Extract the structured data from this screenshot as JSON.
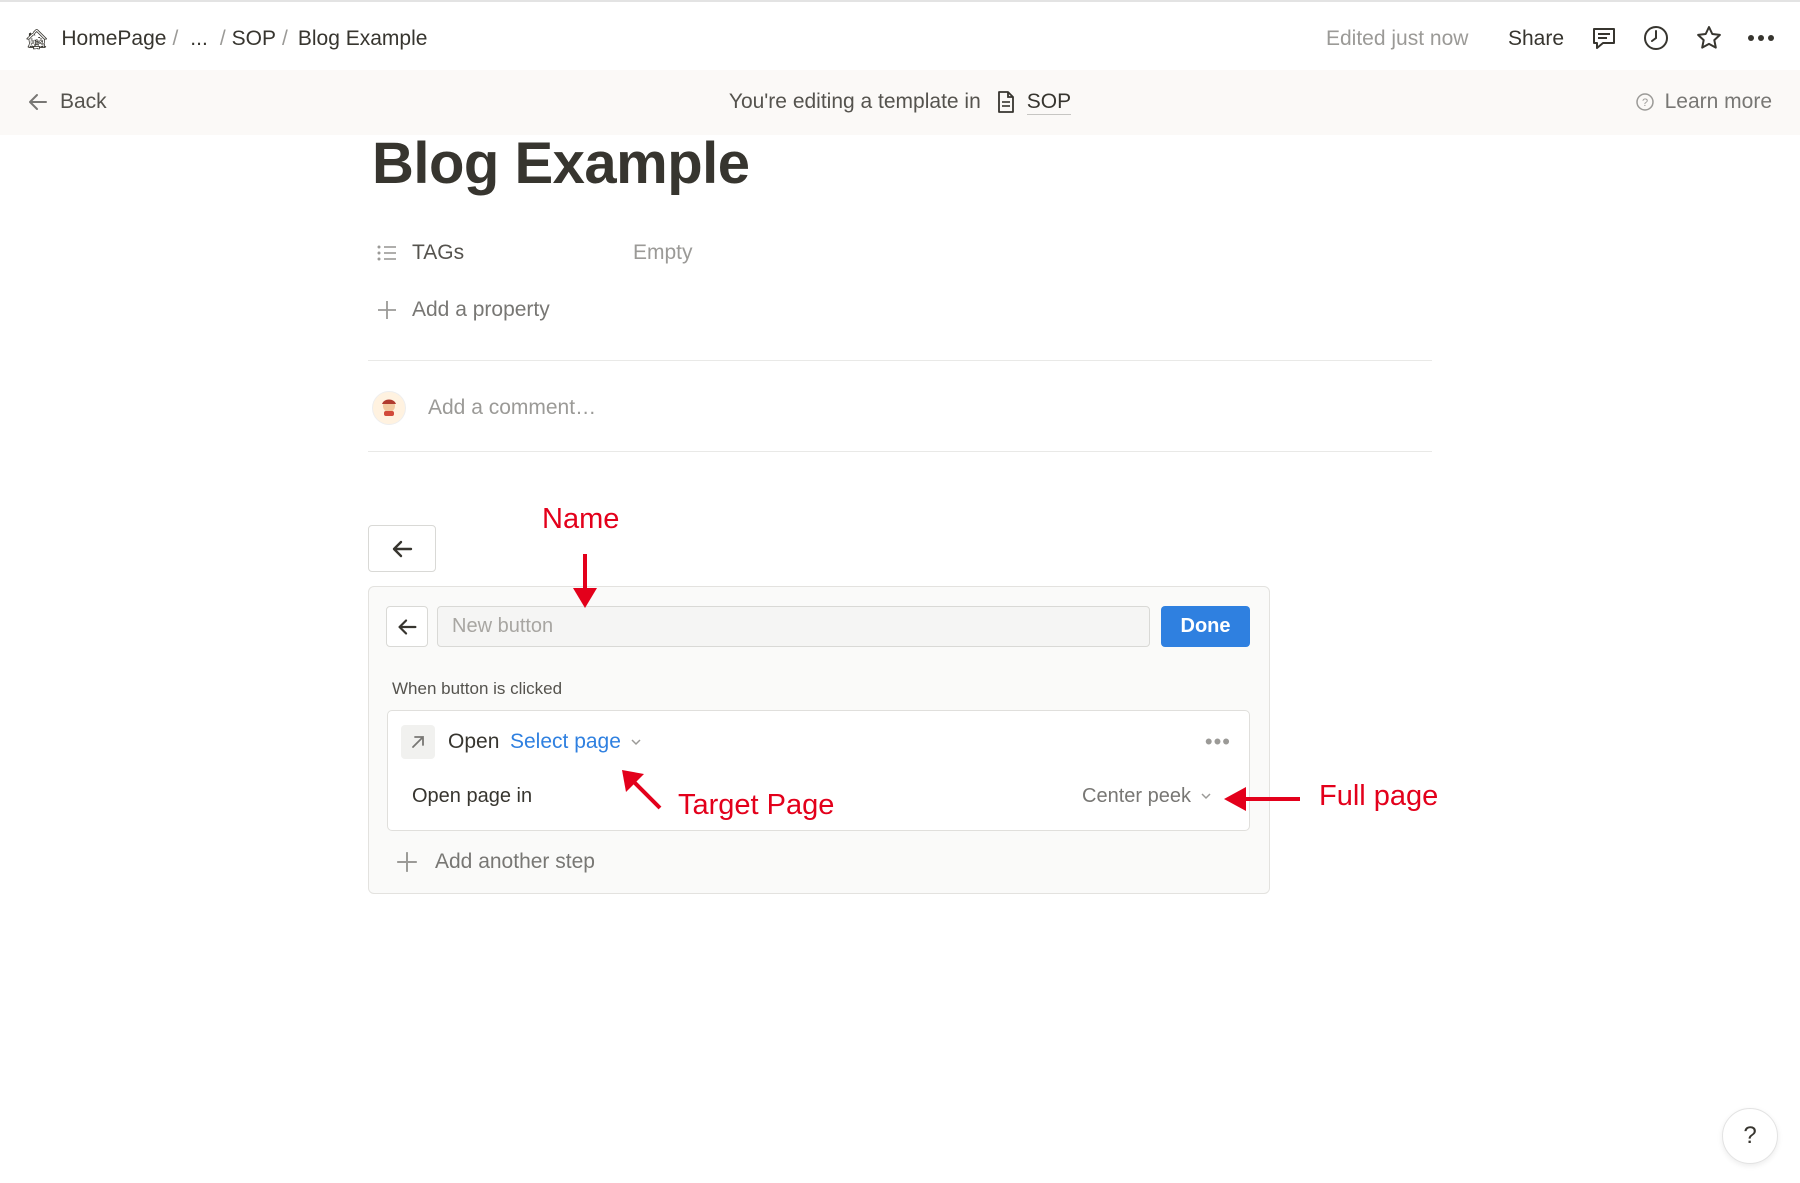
{
  "topbar": {
    "breadcrumb": [
      "HomePage",
      "...",
      "SOP",
      "Blog Example"
    ],
    "separator": "/",
    "edited": "Edited just now",
    "share": "Share"
  },
  "banner": {
    "back": "Back",
    "editing_text": "You're editing a template in",
    "template_name": "SOP",
    "learn_more": "Learn more"
  },
  "page": {
    "title": "Blog Example",
    "property_name": "TAGs",
    "property_value": "Empty",
    "add_property": "Add a property",
    "comment_placeholder": "Add a comment…"
  },
  "button_editor": {
    "name_placeholder": "New button",
    "done": "Done",
    "when_label": "When button is clicked",
    "action": "Open",
    "target": "Select page",
    "open_in_label": "Open page in",
    "open_in_value": "Center peek",
    "more": "•••",
    "add_step": "Add another step"
  },
  "annotations": {
    "name": "Name",
    "target_page": "Target Page",
    "full_page": "Full page",
    "color": "#e3001b"
  },
  "help": "?"
}
